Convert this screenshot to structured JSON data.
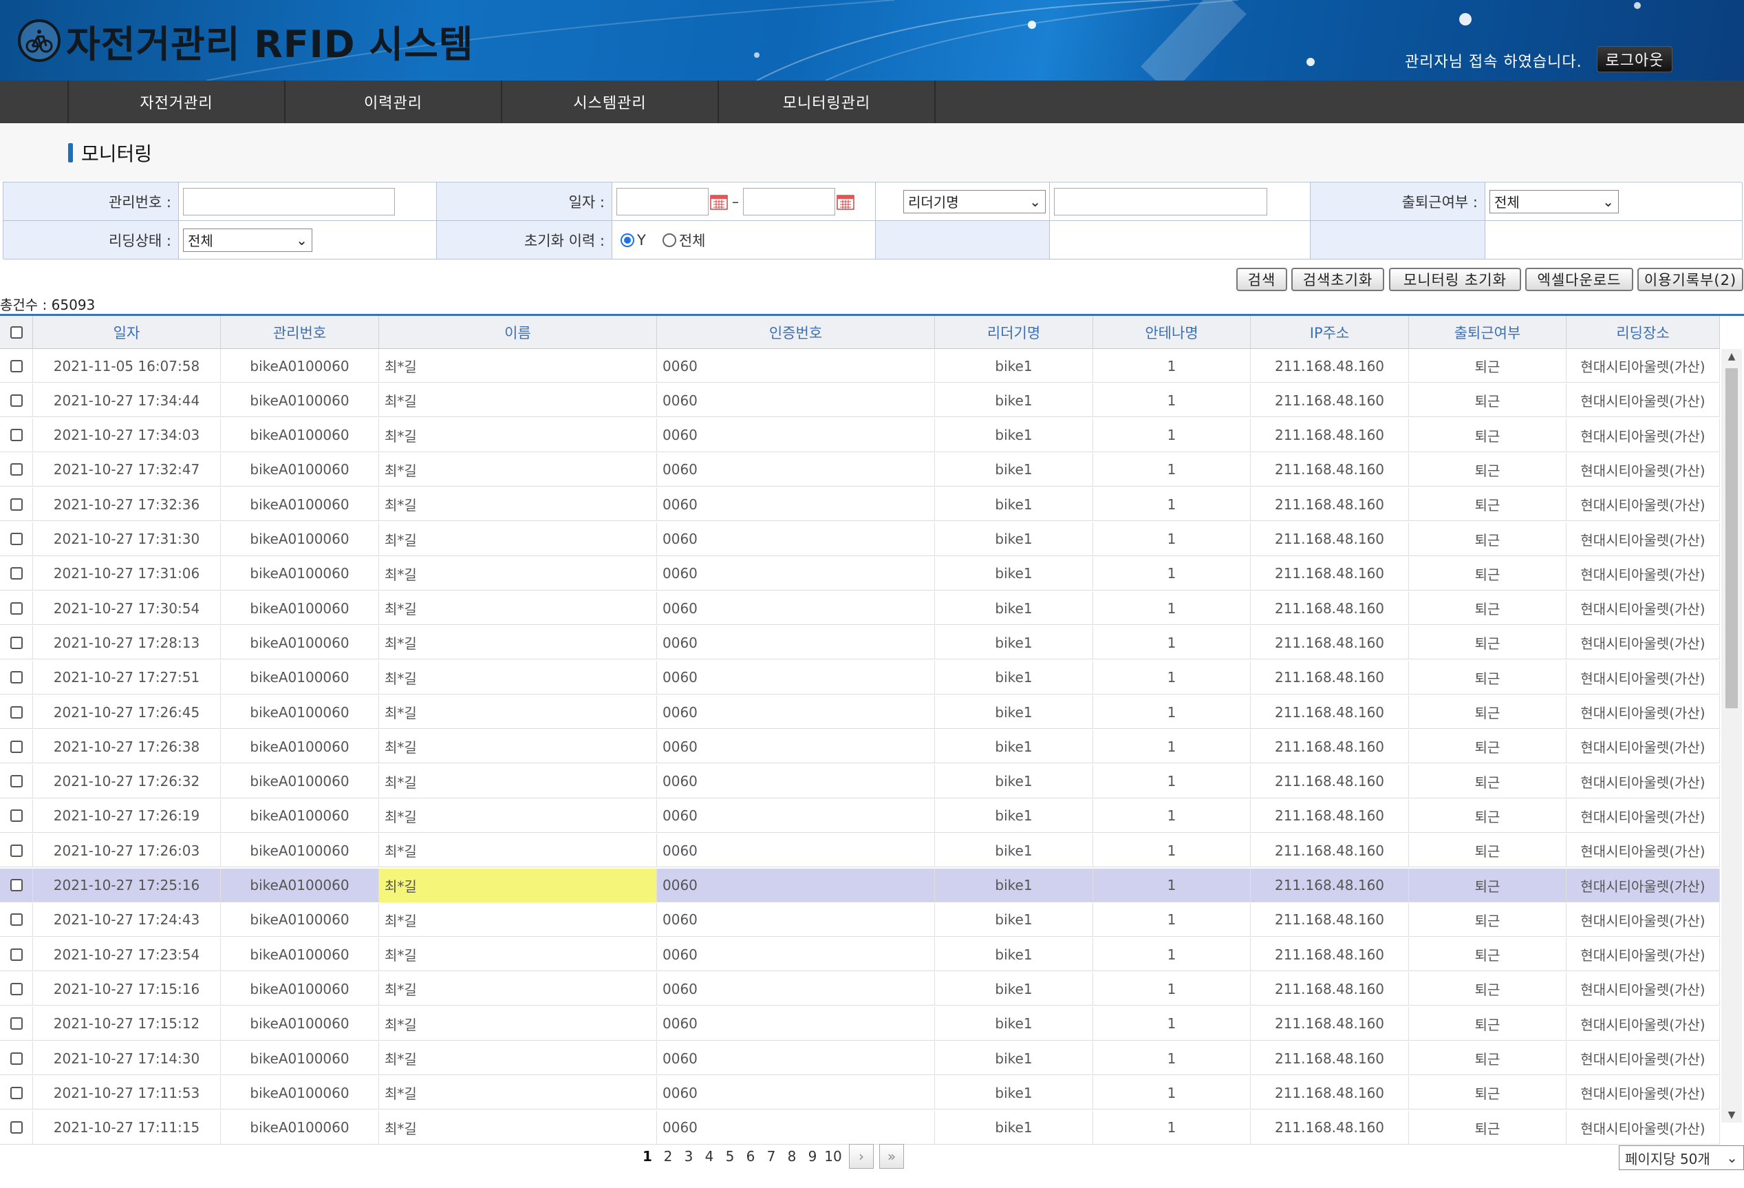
{
  "header": {
    "title": "자전거관리 RFID 시스템",
    "welcome": "관리자님 접속 하였습니다.",
    "logout": "로그아웃"
  },
  "nav": [
    {
      "label": "자전거관리"
    },
    {
      "label": "이력관리"
    },
    {
      "label": "시스템관리"
    },
    {
      "label": "모니터링관리"
    }
  ],
  "page": {
    "title": "모니터링"
  },
  "search": {
    "mgmt_no_label": "관리번호 :",
    "date_label": "일자 :",
    "date_sep": "–",
    "reader_select": "리더기명",
    "commute_label": "출퇴근여부 :",
    "commute_select": "전체",
    "read_status_label": "리딩상태 :",
    "read_status_select": "전체",
    "reset_history_label": "초기화 이력 :",
    "radio_y": "Y",
    "radio_all": "전체"
  },
  "buttons": {
    "search": "검색",
    "search_reset": "검색초기화",
    "monitor_reset": "모니터링 초기화",
    "excel": "엑셀다운로드",
    "usage_log": "이용기록부(2)"
  },
  "total": "총건수 : 65093",
  "table": {
    "headers": [
      "일자",
      "관리번호",
      "이름",
      "인증번호",
      "리더기명",
      "안테나명",
      "IP주소",
      "출퇴근여부",
      "리딩장소"
    ],
    "rows": [
      [
        "2021-11-05 16:07:58",
        "bikeA0100060",
        "최*길",
        "0060",
        "bike1",
        "1",
        "211.168.48.160",
        "퇴근",
        "현대시티아울렛(가산)"
      ],
      [
        "2021-10-27 17:34:44",
        "bikeA0100060",
        "최*길",
        "0060",
        "bike1",
        "1",
        "211.168.48.160",
        "퇴근",
        "현대시티아울렛(가산)"
      ],
      [
        "2021-10-27 17:34:03",
        "bikeA0100060",
        "최*길",
        "0060",
        "bike1",
        "1",
        "211.168.48.160",
        "퇴근",
        "현대시티아울렛(가산)"
      ],
      [
        "2021-10-27 17:32:47",
        "bikeA0100060",
        "최*길",
        "0060",
        "bike1",
        "1",
        "211.168.48.160",
        "퇴근",
        "현대시티아울렛(가산)"
      ],
      [
        "2021-10-27 17:32:36",
        "bikeA0100060",
        "최*길",
        "0060",
        "bike1",
        "1",
        "211.168.48.160",
        "퇴근",
        "현대시티아울렛(가산)"
      ],
      [
        "2021-10-27 17:31:30",
        "bikeA0100060",
        "최*길",
        "0060",
        "bike1",
        "1",
        "211.168.48.160",
        "퇴근",
        "현대시티아울렛(가산)"
      ],
      [
        "2021-10-27 17:31:06",
        "bikeA0100060",
        "최*길",
        "0060",
        "bike1",
        "1",
        "211.168.48.160",
        "퇴근",
        "현대시티아울렛(가산)"
      ],
      [
        "2021-10-27 17:30:54",
        "bikeA0100060",
        "최*길",
        "0060",
        "bike1",
        "1",
        "211.168.48.160",
        "퇴근",
        "현대시티아울렛(가산)"
      ],
      [
        "2021-10-27 17:28:13",
        "bikeA0100060",
        "최*길",
        "0060",
        "bike1",
        "1",
        "211.168.48.160",
        "퇴근",
        "현대시티아울렛(가산)"
      ],
      [
        "2021-10-27 17:27:51",
        "bikeA0100060",
        "최*길",
        "0060",
        "bike1",
        "1",
        "211.168.48.160",
        "퇴근",
        "현대시티아울렛(가산)"
      ],
      [
        "2021-10-27 17:26:45",
        "bikeA0100060",
        "최*길",
        "0060",
        "bike1",
        "1",
        "211.168.48.160",
        "퇴근",
        "현대시티아울렛(가산)"
      ],
      [
        "2021-10-27 17:26:38",
        "bikeA0100060",
        "최*길",
        "0060",
        "bike1",
        "1",
        "211.168.48.160",
        "퇴근",
        "현대시티아울렛(가산)"
      ],
      [
        "2021-10-27 17:26:32",
        "bikeA0100060",
        "최*길",
        "0060",
        "bike1",
        "1",
        "211.168.48.160",
        "퇴근",
        "현대시티아울렛(가산)"
      ],
      [
        "2021-10-27 17:26:19",
        "bikeA0100060",
        "최*길",
        "0060",
        "bike1",
        "1",
        "211.168.48.160",
        "퇴근",
        "현대시티아울렛(가산)"
      ],
      [
        "2021-10-27 17:26:03",
        "bikeA0100060",
        "최*길",
        "0060",
        "bike1",
        "1",
        "211.168.48.160",
        "퇴근",
        "현대시티아울렛(가산)"
      ],
      [
        "2021-10-27 17:25:16",
        "bikeA0100060",
        "최*길",
        "0060",
        "bike1",
        "1",
        "211.168.48.160",
        "퇴근",
        "현대시티아울렛(가산)"
      ],
      [
        "2021-10-27 17:24:43",
        "bikeA0100060",
        "최*길",
        "0060",
        "bike1",
        "1",
        "211.168.48.160",
        "퇴근",
        "현대시티아울렛(가산)"
      ],
      [
        "2021-10-27 17:23:54",
        "bikeA0100060",
        "최*길",
        "0060",
        "bike1",
        "1",
        "211.168.48.160",
        "퇴근",
        "현대시티아울렛(가산)"
      ],
      [
        "2021-10-27 17:15:16",
        "bikeA0100060",
        "최*길",
        "0060",
        "bike1",
        "1",
        "211.168.48.160",
        "퇴근",
        "현대시티아울렛(가산)"
      ],
      [
        "2021-10-27 17:15:12",
        "bikeA0100060",
        "최*길",
        "0060",
        "bike1",
        "1",
        "211.168.48.160",
        "퇴근",
        "현대시티아울렛(가산)"
      ],
      [
        "2021-10-27 17:14:30",
        "bikeA0100060",
        "최*길",
        "0060",
        "bike1",
        "1",
        "211.168.48.160",
        "퇴근",
        "현대시티아울렛(가산)"
      ],
      [
        "2021-10-27 17:11:53",
        "bikeA0100060",
        "최*길",
        "0060",
        "bike1",
        "1",
        "211.168.48.160",
        "퇴근",
        "현대시티아울렛(가산)"
      ],
      [
        "2021-10-27 17:11:15",
        "bikeA0100060",
        "최*길",
        "0060",
        "bike1",
        "1",
        "211.168.48.160",
        "퇴근",
        "현대시티아울렛(가산)"
      ]
    ],
    "selected_row_index": 15
  },
  "pagination": {
    "pages": [
      "1",
      "2",
      "3",
      "4",
      "5",
      "6",
      "7",
      "8",
      "9",
      "10"
    ],
    "current": "1",
    "next": "›",
    "last": "»"
  },
  "per_page": "페이지당 50개",
  "colors": {
    "accent": "#3a72b8",
    "nav_bg": "#3d3d3d",
    "selected_row": "#d0d0ef",
    "highlight_cell": "#f5f57a"
  }
}
